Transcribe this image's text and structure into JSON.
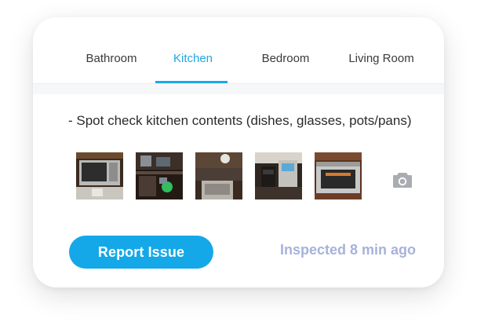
{
  "tabs": [
    {
      "label": "Bathroom",
      "active": false
    },
    {
      "label": "Kitchen",
      "active": true
    },
    {
      "label": "Bedroom",
      "active": false
    },
    {
      "label": "Living Room",
      "active": false
    }
  ],
  "task": {
    "text": "- Spot check kitchen contents (dishes, glasses, pots/pans)"
  },
  "photos": [
    {
      "subject": "microwave"
    },
    {
      "subject": "cabinet-shelf"
    },
    {
      "subject": "countertop"
    },
    {
      "subject": "coffee-maker"
    },
    {
      "subject": "wall-oven"
    }
  ],
  "actions": {
    "camera_icon": "camera-icon",
    "report_label": "Report Issue",
    "inspected_text": "Inspected 8 min ago"
  },
  "colors": {
    "accent": "#1fa6e8",
    "button": "#14a8e8",
    "inspected": "#a7b2db"
  }
}
